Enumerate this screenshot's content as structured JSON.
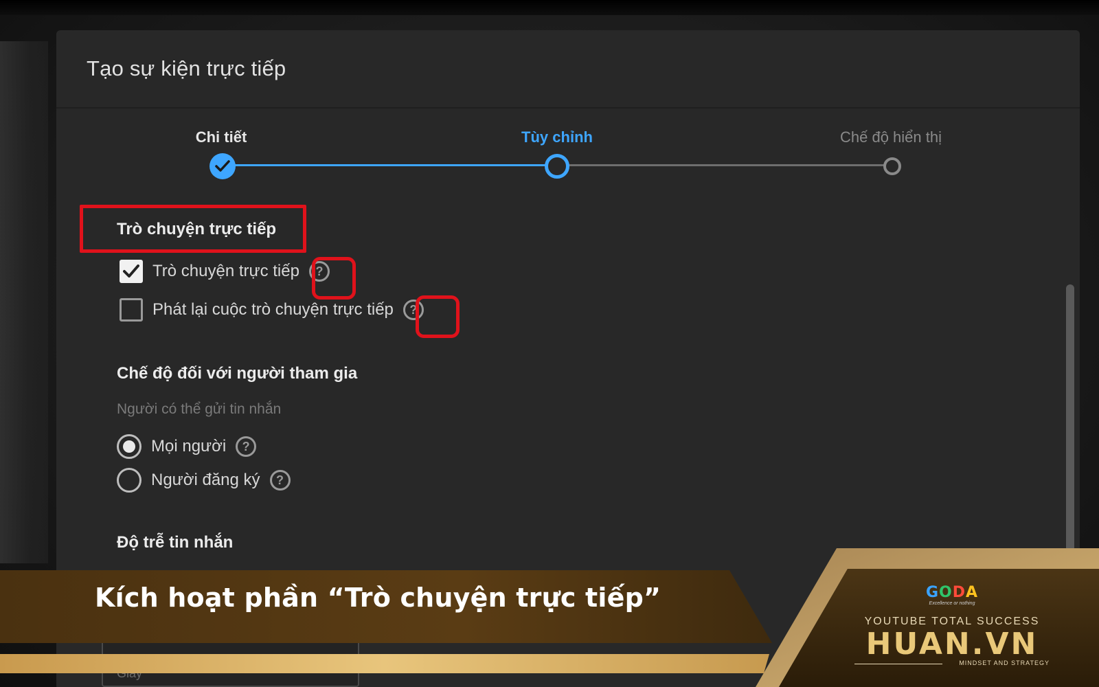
{
  "dialog": {
    "title": "Tạo sự kiện trực tiếp"
  },
  "stepper": {
    "steps": [
      {
        "label": "Chi tiết",
        "state": "done"
      },
      {
        "label": "Tùy chỉnh",
        "state": "active"
      },
      {
        "label": "Chế độ hiển thị",
        "state": "todo"
      }
    ]
  },
  "live_chat": {
    "section_title": "Trò chuyện trực tiếp",
    "options": [
      {
        "label": "Trò chuyện trực tiếp",
        "checked": true
      },
      {
        "label": "Phát lại cuộc trò chuyện trực tiếp",
        "checked": false
      }
    ]
  },
  "participant_mode": {
    "section_title": "Chế độ đối với người tham gia",
    "sublabel": "Người có thể gửi tin nhắn",
    "options": [
      {
        "label": "Mọi người",
        "selected": true
      },
      {
        "label": "Người đăng ký",
        "selected": false
      }
    ]
  },
  "message_delay": {
    "section_title": "Độ trễ tin nhắn",
    "peek_value": "Giây"
  },
  "banner": {
    "caption": "Kích hoạt phần “Trò chuyện trực tiếp”",
    "goda_letters": [
      "G",
      "O",
      "D",
      "A"
    ],
    "goda_tagline": "Excellence or nothing",
    "tagline": "YOUTUBE TOTAL SUCCESS",
    "brand": "HUAN.VN",
    "subtitle": "MINDSET AND STRATEGY"
  },
  "colors": {
    "accent": "#3ea6ff",
    "highlight": "#e0121b",
    "gold": "#e9c879",
    "banner_brown": "#4a3212"
  },
  "icons": {
    "check": "check-icon",
    "help": "help-circle-icon"
  }
}
